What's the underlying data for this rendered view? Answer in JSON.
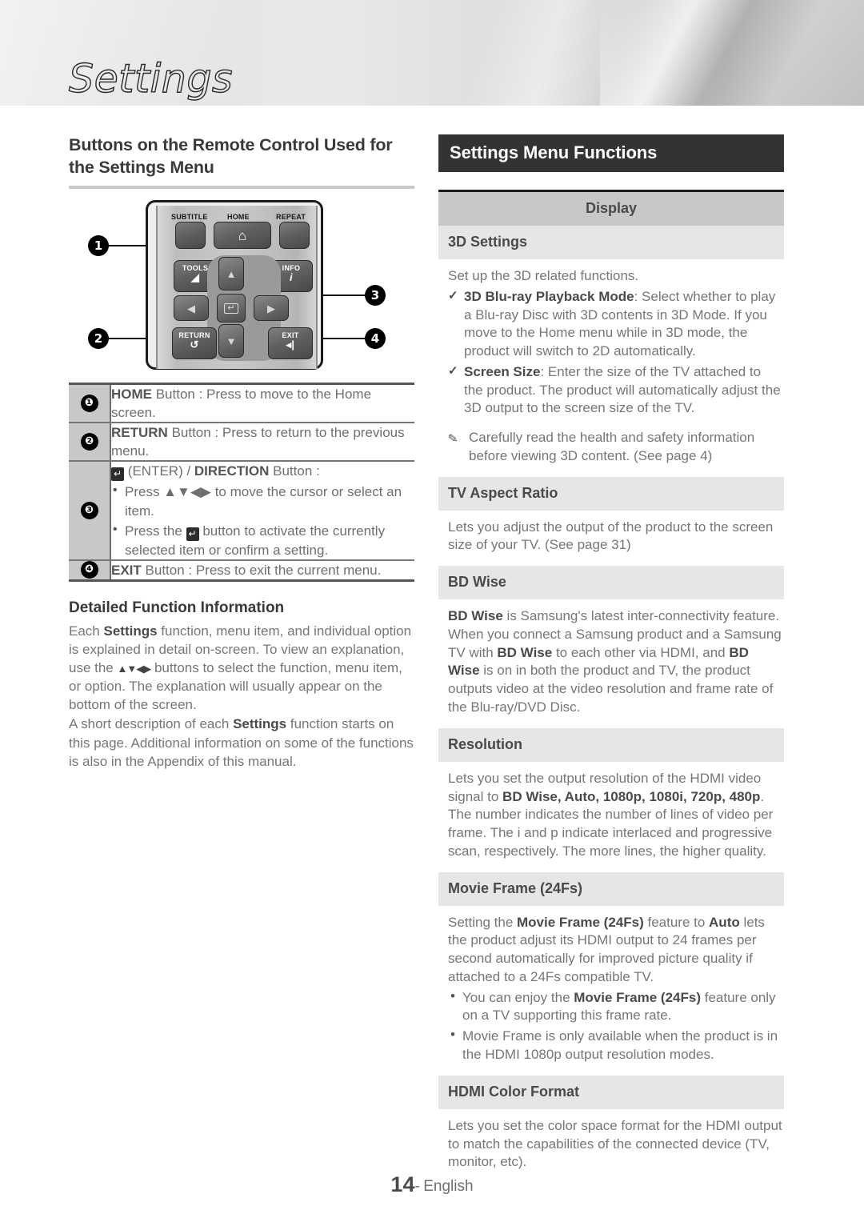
{
  "page": {
    "chapter_title": "Settings",
    "footer_page_number": "14",
    "footer_separator": "-",
    "footer_language": "English"
  },
  "left": {
    "heading": "Buttons on the Remote Control Used for the Settings Menu",
    "remote": {
      "buttons": [
        {
          "name": "SUBTITLE",
          "label": "SUBTITLE"
        },
        {
          "name": "HOME",
          "label": "HOME",
          "glyph": "⌂"
        },
        {
          "name": "REPEAT",
          "label": "REPEAT"
        },
        {
          "name": "TOOLS",
          "label": "TOOLS"
        },
        {
          "name": "INFO",
          "label": "INFO",
          "glyph": "i"
        },
        {
          "name": "RETURN",
          "label": "RETURN",
          "glyph": "↺"
        },
        {
          "name": "EXIT",
          "label": "EXIT"
        },
        {
          "name": "UP",
          "glyph": "▲"
        },
        {
          "name": "DOWN",
          "glyph": "▼"
        },
        {
          "name": "LEFT",
          "glyph": "◀"
        },
        {
          "name": "RIGHT",
          "glyph": "▶"
        },
        {
          "name": "ENTER",
          "glyph": "↵"
        }
      ],
      "callouts": [
        "1",
        "2",
        "3",
        "4"
      ]
    },
    "button_table": [
      {
        "num": "❶",
        "name": "HOME Button",
        "text_bold": "HOME",
        "text_rest": " Button : Press to move to the Home screen."
      },
      {
        "num": "❷",
        "name": "RETURN Button",
        "text_bold": "RETURN",
        "text_rest": " Button : Press to return to the previous menu."
      },
      {
        "num": "❸",
        "name": "ENTER / DIRECTION Button",
        "title_rest": "(ENTER) / ",
        "title_bold": "DIRECTION",
        "title_tail": " Button :",
        "bullets": [
          "Press ▲▼◀▶ to move the cursor or select an item.",
          "Press the button to activate the currently selected item or confirm a setting."
        ]
      },
      {
        "num": "❹",
        "name": "EXIT Button",
        "text_bold": "EXIT",
        "text_rest": " Button : Press to exit the current menu."
      }
    ],
    "detailed": {
      "heading": "Detailed Function Information",
      "p1_a": "Each ",
      "p1_b": "Settings",
      "p1_c": " function, menu item, and individual option is explained in detail on-screen. To view an explanation, use the ",
      "p1_arrows": "▲▼◀▶",
      "p1_d": " buttons to select the function, menu item, or option. The explanation will usually appear on the bottom of the screen.",
      "p2_a": "A short description of each ",
      "p2_b": "Settings",
      "p2_c": " function starts on this page. Additional information on some of the functions is also in the Appendix of this manual."
    }
  },
  "right": {
    "section_header": "Settings Menu Functions",
    "category": "Display",
    "items": [
      {
        "title": "3D Settings",
        "intro": "Set up the 3D related functions.",
        "checks": [
          {
            "bold": "3D Blu-ray Playback Mode",
            "rest": ": Select whether to play a Blu-ray Disc with 3D contents in 3D Mode. If you move to the Home menu while in 3D mode, the product will switch to 2D automatically."
          },
          {
            "bold": "Screen Size",
            "rest": ": Enter the size of the TV attached to the product. The product will automatically adjust the 3D output to the screen size of the TV."
          }
        ],
        "note": "Carefully read the health and safety information before viewing 3D content. (See page 4)"
      },
      {
        "title": "TV Aspect Ratio",
        "body": "Lets you adjust the output of the product to the screen size of your TV. (See page 31)"
      },
      {
        "title": "BD Wise",
        "body_parts": [
          {
            "bold": true,
            "t": "BD Wise"
          },
          {
            "bold": false,
            "t": " is Samsung's latest inter-connectivity feature. When you connect a Samsung product and a Samsung TV with "
          },
          {
            "bold": true,
            "t": "BD Wise"
          },
          {
            "bold": false,
            "t": " to each other via HDMI, and "
          },
          {
            "bold": true,
            "t": "BD Wise"
          },
          {
            "bold": false,
            "t": " is on in both the product and TV, the product outputs video at the video resolution and frame rate of the Blu-ray/DVD Disc."
          }
        ]
      },
      {
        "title": "Resolution",
        "body_parts": [
          {
            "bold": false,
            "t": "Lets you set the output resolution of the HDMI video signal to "
          },
          {
            "bold": true,
            "t": "BD Wise, Auto, 1080p, 1080i, 720p, 480p"
          },
          {
            "bold": false,
            "t": ". The number indicates the number of lines of video per frame. The i and p indicate interlaced and progressive scan, respectively. The more lines, the higher quality."
          }
        ]
      },
      {
        "title": "Movie Frame (24Fs)",
        "body_parts": [
          {
            "bold": false,
            "t": "Setting the "
          },
          {
            "bold": true,
            "t": "Movie Frame (24Fs)"
          },
          {
            "bold": false,
            "t": " feature to "
          },
          {
            "bold": true,
            "t": "Auto"
          },
          {
            "bold": false,
            "t": " lets the product adjust its HDMI output to 24 frames per second automatically for improved picture quality if attached to a 24Fs compatible TV."
          }
        ],
        "dots": [
          {
            "pre": "You can enjoy the ",
            "bold": "Movie Frame (24Fs)",
            "post": " feature only on a TV supporting this frame rate."
          },
          {
            "pre": "Movie Frame is only available when the product is in the HDMI 1080p output resolution modes.",
            "bold": "",
            "post": ""
          }
        ]
      },
      {
        "title": "HDMI Color Format",
        "body": "Lets you set the color space format for the HDMI output to match the capabilities of the connected device (TV, monitor, etc)."
      }
    ]
  }
}
